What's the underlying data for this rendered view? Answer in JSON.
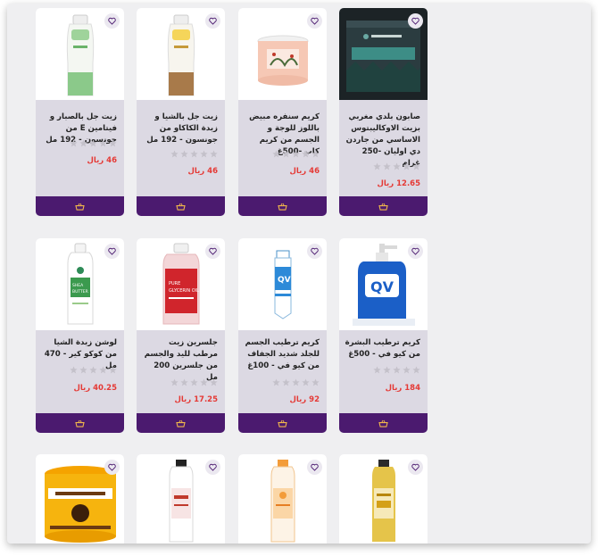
{
  "products": [
    {
      "name": "صابون بلدي مغربي بزيت الاوكاليبتوس الاساسي من جاردن دي اوليان -250 غرام",
      "price": "12.65 ريال",
      "rating": 0,
      "image": "black-soap-jar",
      "action": "add-to-cart"
    },
    {
      "name": "كريم سنفره مبيض باللوز للوجة و الجسم من كريم كاب -500غ",
      "price": "46 ريال",
      "rating": 0,
      "image": "cream-jar",
      "action": "add-to-cart"
    },
    {
      "name": "زيت جل بالشيا و زبدة الكاكاو من جونسون - 192 مل",
      "price": "46 ريال",
      "rating": 0,
      "image": "oil-gel-bottle-yellow",
      "action": "add-to-cart"
    },
    {
      "name": "زيت جل بالصبار و فيتامين E من جونسون - 192 مل",
      "price": "46 ريال",
      "rating": 0,
      "image": "oil-gel-bottle-green",
      "action": "add-to-cart"
    },
    {
      "name": "كريم ترطيب البشرة من كيو في - 500غ",
      "price": "184 ريال",
      "rating": 0,
      "image": "qv-pump-bottle",
      "action": "add-to-cart"
    },
    {
      "name": "كريم ترطيب الجسم للجلد شديد الجفاف من كيو في - 100غ",
      "price": "92 ريال",
      "rating": 0,
      "image": "qv-tube",
      "action": "add-to-cart"
    },
    {
      "name": "جلسرين زيت مرطب لليد والجسم من جلسرين 200 مل",
      "price": "17.25 ريال",
      "rating": 0,
      "image": "glycerin-bottle",
      "action": "add-to-cart"
    },
    {
      "name": "لوشن زبدة الشيا من كوكو كير - 470 مل",
      "price": "40.25 ريال",
      "rating": 0,
      "image": "shea-lotion-bottle",
      "action": "add-to-cart"
    },
    {
      "name": "",
      "price": "",
      "rating": 0,
      "image": "vitamin-e-bottle-yellow",
      "action": "add-to-cart"
    },
    {
      "name": "",
      "price": "",
      "rating": 0,
      "image": "vitamin-c-bottle-orange",
      "action": "add-to-cart"
    },
    {
      "name": "",
      "price": "",
      "rating": 0,
      "image": "vitamin-bottle-red",
      "action": "add-to-cart"
    },
    {
      "name": "",
      "price": "",
      "rating": 0,
      "image": "cocoa-butter-jar",
      "action": "add-to-cart"
    }
  ],
  "colors": {
    "accent": "#4b1a6f",
    "price": "#e53935",
    "card": "#dcd9e3",
    "star": "#c4c1ca"
  }
}
